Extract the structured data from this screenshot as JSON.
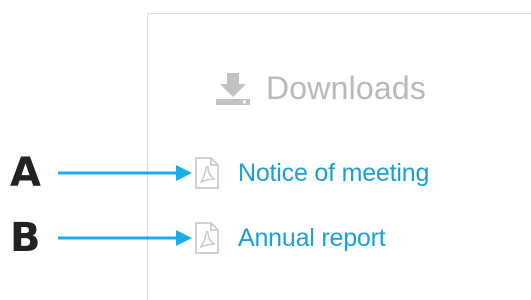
{
  "panel": {
    "title": "Downloads",
    "title_icon": "download-icon",
    "links": [
      {
        "label": "Notice of meeting",
        "icon": "pdf-file-icon"
      },
      {
        "label": "Annual report",
        "icon": "pdf-file-icon"
      }
    ]
  },
  "annotations": [
    {
      "letter": "A",
      "icon": "arrow-right-icon"
    },
    {
      "letter": "B",
      "icon": "arrow-right-icon"
    }
  ],
  "colors": {
    "link": "#1aa0d8",
    "arrow": "#19aee6",
    "muted": "#b8b8b8",
    "annotation_letter": "#222222"
  }
}
